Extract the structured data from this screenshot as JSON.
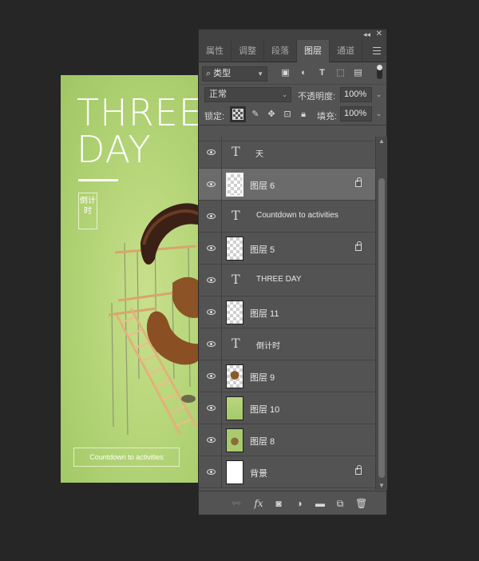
{
  "poster": {
    "title_line1": "THREE",
    "title_line2": "DAY",
    "vertical_text": "倒计时",
    "cta": "Countdown to activities"
  },
  "panel": {
    "tabs": [
      {
        "label": "属性"
      },
      {
        "label": "调整"
      },
      {
        "label": "段落"
      },
      {
        "label": "图层"
      },
      {
        "label": "通道"
      }
    ],
    "active_tab": "图层",
    "filter": {
      "kind_label": "类型"
    },
    "blend_mode": "正常",
    "opacity_label": "不透明度:",
    "opacity_value": "100%",
    "lock_label": "锁定:",
    "fill_label": "填充:",
    "fill_value": "100%",
    "layers": [
      {
        "name": "天",
        "kind": "text",
        "locked": false,
        "selected": false
      },
      {
        "name": "图层 6",
        "kind": "pixel",
        "locked": true,
        "selected": true
      },
      {
        "name": "Countdown to activities",
        "kind": "text",
        "locked": false,
        "selected": false
      },
      {
        "name": "图层 5",
        "kind": "pixel",
        "locked": true,
        "selected": false
      },
      {
        "name": "THREE DAY",
        "kind": "text",
        "locked": false,
        "selected": false
      },
      {
        "name": "图层 11",
        "kind": "pixel",
        "locked": false,
        "selected": false
      },
      {
        "name": "倒计时",
        "kind": "text",
        "locked": false,
        "selected": false
      },
      {
        "name": "图层 9",
        "kind": "pixel",
        "locked": false,
        "selected": false
      },
      {
        "name": "图层 10",
        "kind": "pixel",
        "locked": false,
        "selected": false
      },
      {
        "name": "图层 8",
        "kind": "pixel",
        "locked": false,
        "selected": false
      },
      {
        "name": "背景",
        "kind": "background",
        "locked": true,
        "selected": false
      }
    ],
    "bottom_icons": [
      "link-icon",
      "fx-icon",
      "mask-icon",
      "adjustment-icon",
      "folder-icon",
      "new-layer-icon",
      "trash-icon"
    ],
    "fx_label": "fx"
  },
  "colors": {
    "workspace": "#262626",
    "panel": "#535353",
    "selected_row": "#6b6b6b",
    "poster_green": "#b5d578"
  }
}
